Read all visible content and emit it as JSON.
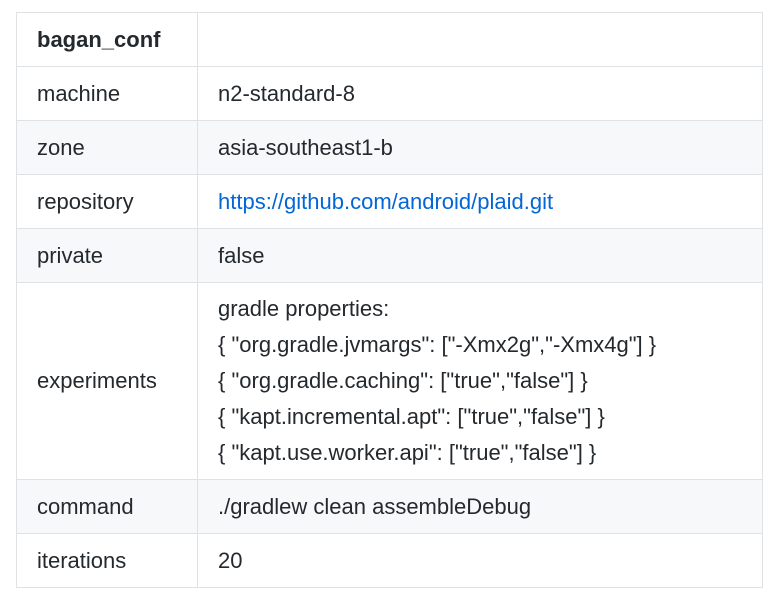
{
  "table": {
    "header": [
      "bagan_conf",
      ""
    ],
    "rows": {
      "machine": {
        "label": "machine",
        "value": "n2-standard-8"
      },
      "zone": {
        "label": "zone",
        "value": "asia-southeast1-b"
      },
      "repository": {
        "label": "repository",
        "value": "https://github.com/android/plaid.git"
      },
      "private": {
        "label": "private",
        "value": "false"
      },
      "experiments": {
        "label": "experiments",
        "lines": [
          "gradle properties:",
          "{ \"org.gradle.jvmargs\": [\"-Xmx2g\",\"-Xmx4g\"] }",
          "{ \"org.gradle.caching\": [\"true\",\"false\"] }",
          "{ \"kapt.incremental.apt\": [\"true\",\"false\"] }",
          "{ \"kapt.use.worker.api\": [\"true\",\"false\"] }"
        ]
      },
      "command": {
        "label": "command",
        "value": "./gradlew clean assembleDebug"
      },
      "iterations": {
        "label": "iterations",
        "value": "20"
      }
    }
  },
  "colors": {
    "link": "#0366d6",
    "border": "#dfe2e5",
    "alt_row": "#f6f8fa",
    "text": "#24292e"
  }
}
